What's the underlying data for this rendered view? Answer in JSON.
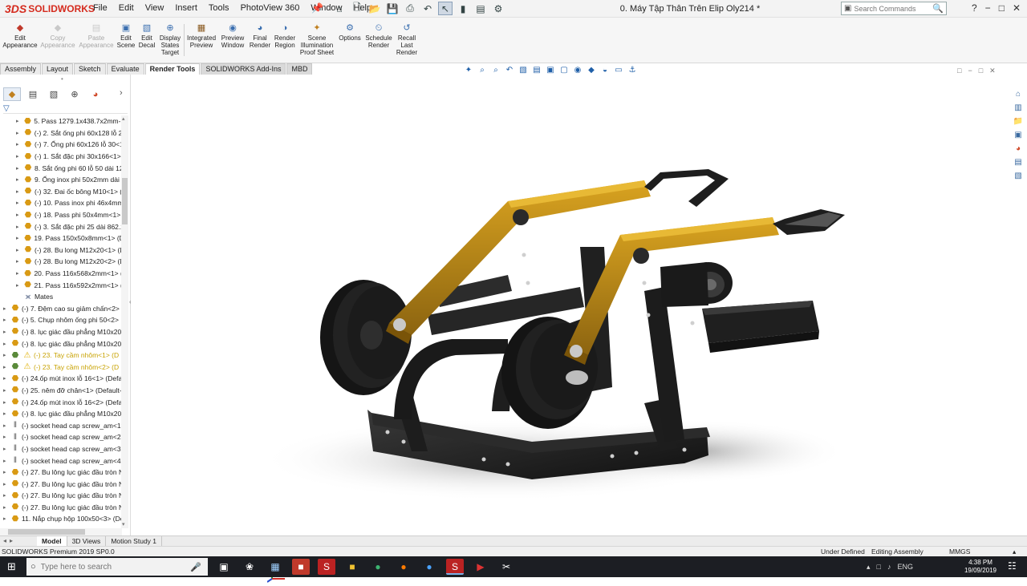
{
  "app": {
    "logo_mark": "3DS",
    "logo_text": "SOLIDWORKS",
    "document_title": "0. Máy Tập Thân Trên Elip Oly214 *",
    "menus": [
      "File",
      "Edit",
      "View",
      "Insert",
      "Tools",
      "PhotoView 360",
      "Window",
      "Help"
    ],
    "search_placeholder": "Search Commands"
  },
  "ribbon": {
    "buttons": [
      {
        "label": "Edit\nAppearance",
        "icon": "edit-appearance-icon",
        "enabled": true
      },
      {
        "label": "Copy\nAppearance",
        "icon": "copy-appearance-icon",
        "enabled": false
      },
      {
        "label": "Paste\nAppearance",
        "icon": "paste-appearance-icon",
        "enabled": false
      },
      {
        "label": "Edit\nScene",
        "icon": "edit-scene-icon",
        "enabled": true
      },
      {
        "label": "Edit\nDecal",
        "icon": "edit-decal-icon",
        "enabled": true
      },
      {
        "label": "Display\nStates\nTarget",
        "icon": "display-states-icon",
        "enabled": true
      },
      {
        "label": "Integrated\nPreview",
        "icon": "integrated-preview-icon",
        "enabled": true
      },
      {
        "label": "Preview\nWindow",
        "icon": "preview-window-icon",
        "enabled": true
      },
      {
        "label": "Final\nRender",
        "icon": "final-render-icon",
        "enabled": true
      },
      {
        "label": "Render\nRegion",
        "icon": "render-region-icon",
        "enabled": true
      },
      {
        "label": "Scene\nIllumination\nProof Sheet",
        "icon": "scene-illumination-icon",
        "enabled": true
      },
      {
        "label": "Options",
        "icon": "options-icon",
        "enabled": true
      },
      {
        "label": "Schedule\nRender",
        "icon": "schedule-render-icon",
        "enabled": true
      },
      {
        "label": "Recall\nLast\nRender",
        "icon": "recall-last-render-icon",
        "enabled": true
      }
    ]
  },
  "command_tabs": [
    "Assembly",
    "Layout",
    "Sketch",
    "Evaluate",
    "Render Tools",
    "SOLIDWORKS Add-Ins",
    "MBD"
  ],
  "active_command_tab": "Render Tools",
  "feature_tree": {
    "items": [
      {
        "label": "5. Pass 1279.1x438.7x2mm-1<",
        "indent": 1,
        "type": "part",
        "warn": false
      },
      {
        "label": "(-) 2. Sắt ống phi 60x128 lỗ 25",
        "indent": 1,
        "type": "part",
        "warn": false
      },
      {
        "label": "(-) 7. Ống phi 60x126 lỗ 30<1",
        "indent": 1,
        "type": "part",
        "warn": false
      },
      {
        "label": "(-) 1. Sắt đặc phi 30x166<1> (",
        "indent": 1,
        "type": "part",
        "warn": false
      },
      {
        "label": "8. Sắt ống phi 60 lỗ 50 dài 12",
        "indent": 1,
        "type": "part",
        "warn": false
      },
      {
        "label": "9. Ống inox phi 50x2mm dài",
        "indent": 1,
        "type": "part",
        "warn": false
      },
      {
        "label": "(-) 32. Đai ốc bông M10<1> (",
        "indent": 1,
        "type": "part",
        "warn": false
      },
      {
        "label": "(-) 10. Pass inox phi 46x4mm",
        "indent": 1,
        "type": "part",
        "warn": false
      },
      {
        "label": "(-) 18. Pass phi 50x4mm<1>",
        "indent": 1,
        "type": "part",
        "warn": false
      },
      {
        "label": "(-) 3. Sắt đặc phi 25 dài 862.2",
        "indent": 1,
        "type": "part",
        "warn": false
      },
      {
        "label": "19. Pass 150x50x8mm<1> (De",
        "indent": 1,
        "type": "part",
        "warn": false
      },
      {
        "label": "(-) 28. Bu long M12x20<1> (D",
        "indent": 1,
        "type": "part",
        "warn": false
      },
      {
        "label": "(-) 28. Bu long M12x20<2> (D",
        "indent": 1,
        "type": "part",
        "warn": false
      },
      {
        "label": "20. Pass 116x568x2mm<1> (D",
        "indent": 1,
        "type": "part",
        "warn": false
      },
      {
        "label": "21. Pass 116x592x2mm<1> (D",
        "indent": 1,
        "type": "part",
        "warn": false
      },
      {
        "label": "Mates",
        "indent": 1,
        "type": "mates",
        "warn": false
      },
      {
        "label": "(-) 7. Đệm cao su giảm chấn<2>",
        "indent": 0,
        "type": "part",
        "warn": false
      },
      {
        "label": "(-) 5. Chụp nhôm ống phi 50<2>",
        "indent": 0,
        "type": "part",
        "warn": false
      },
      {
        "label": "(-) 8. lục giác đầu phẳng M10x20",
        "indent": 0,
        "type": "part",
        "warn": false
      },
      {
        "label": "(-) 8. lục giác đầu phẳng M10x20",
        "indent": 0,
        "type": "part",
        "warn": false
      },
      {
        "label": "(-) 23. Tay cầm nhôm<1> (D",
        "indent": 0,
        "type": "assembly",
        "warn": true
      },
      {
        "label": "(-) 23. Tay cầm nhôm<2> (D",
        "indent": 0,
        "type": "assembly",
        "warn": true
      },
      {
        "label": "(-) 24.ốp mút inox lỗ 16<1> (Defa",
        "indent": 0,
        "type": "part",
        "warn": false
      },
      {
        "label": "(-) 25. nêm đỡ chân<1> (Default-",
        "indent": 0,
        "type": "part",
        "warn": false
      },
      {
        "label": "(-) 24.ốp mút inox lỗ 16<2> (Defa",
        "indent": 0,
        "type": "part",
        "warn": false
      },
      {
        "label": "(-) 8. lục giác đầu phẳng M10x20",
        "indent": 0,
        "type": "part",
        "warn": false
      },
      {
        "label": "(-) socket head cap screw_am<1>",
        "indent": 0,
        "type": "screw",
        "warn": false
      },
      {
        "label": "(-) socket head cap screw_am<2>",
        "indent": 0,
        "type": "screw",
        "warn": false
      },
      {
        "label": "(-) socket head cap screw_am<3>",
        "indent": 0,
        "type": "screw",
        "warn": false
      },
      {
        "label": "(-) socket head cap screw_am<4>",
        "indent": 0,
        "type": "screw",
        "warn": false
      },
      {
        "label": "(-) 27. Bu lông lục giác đầu tròn N",
        "indent": 0,
        "type": "part",
        "warn": false
      },
      {
        "label": "(-) 27. Bu lông lục giác đầu tròn N",
        "indent": 0,
        "type": "part",
        "warn": false
      },
      {
        "label": "(-) 27. Bu lông lục giác đầu tròn N",
        "indent": 0,
        "type": "part",
        "warn": false
      },
      {
        "label": "(-) 27. Bu lông lục giác đầu tròn N",
        "indent": 0,
        "type": "part",
        "warn": false
      },
      {
        "label": "11. Nắp chụp hộp 100x50<3> (De",
        "indent": 0,
        "type": "part",
        "warn": false
      }
    ]
  },
  "bottom_tabs": [
    "Model",
    "3D Views",
    "Motion Study 1"
  ],
  "active_bottom_tab": "Model",
  "status": {
    "product": "SOLIDWORKS Premium 2019 SP0.0",
    "definition": "Under Defined",
    "mode": "Editing Assembly",
    "units": "MMGS"
  },
  "taskbar": {
    "search_placeholder": "Type here to search",
    "language": "ENG",
    "time": "4:38 PM",
    "date": "19/09/2019"
  },
  "colors": {
    "brand_red": "#d52b1e",
    "arm_gold": "#b8860b",
    "frame_black": "#1f1f1f",
    "warning_yellow": "#c8a200",
    "taskbar_bg": "#1c1e23"
  }
}
